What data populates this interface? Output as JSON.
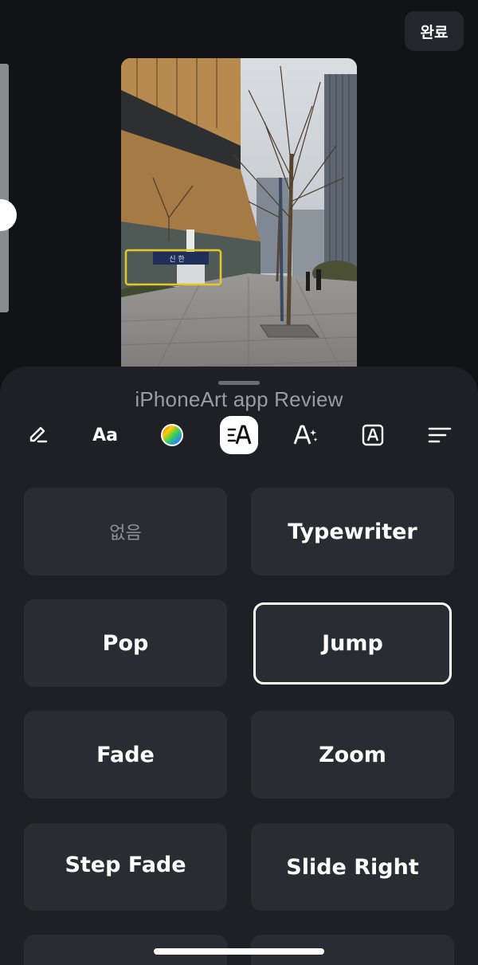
{
  "header": {
    "done_label": "완료"
  },
  "preview": {
    "sign_text": "신 한"
  },
  "sheet": {
    "title": "iPhoneArt app Review",
    "tools": [
      {
        "name": "pen-icon"
      },
      {
        "name": "font-icon",
        "label": "Aa"
      },
      {
        "name": "color-wheel-icon"
      },
      {
        "name": "text-animation-icon",
        "selected": true
      },
      {
        "name": "text-effects-icon"
      },
      {
        "name": "text-background-icon"
      },
      {
        "name": "text-align-icon"
      }
    ],
    "animations": [
      {
        "label": "없음"
      },
      {
        "label": "Typewriter"
      },
      {
        "label": "Pop"
      },
      {
        "label": "Jump",
        "selected": true
      },
      {
        "label": "Fade"
      },
      {
        "label": "Zoom"
      },
      {
        "label": "Step Fade"
      },
      {
        "label": "Slide Right"
      }
    ]
  },
  "colors": {
    "background": "#121316",
    "sheet": "#1e2025",
    "card": "#2a2c33",
    "selected_border": "#ffffff",
    "highlight_box": "#e6c72a"
  }
}
